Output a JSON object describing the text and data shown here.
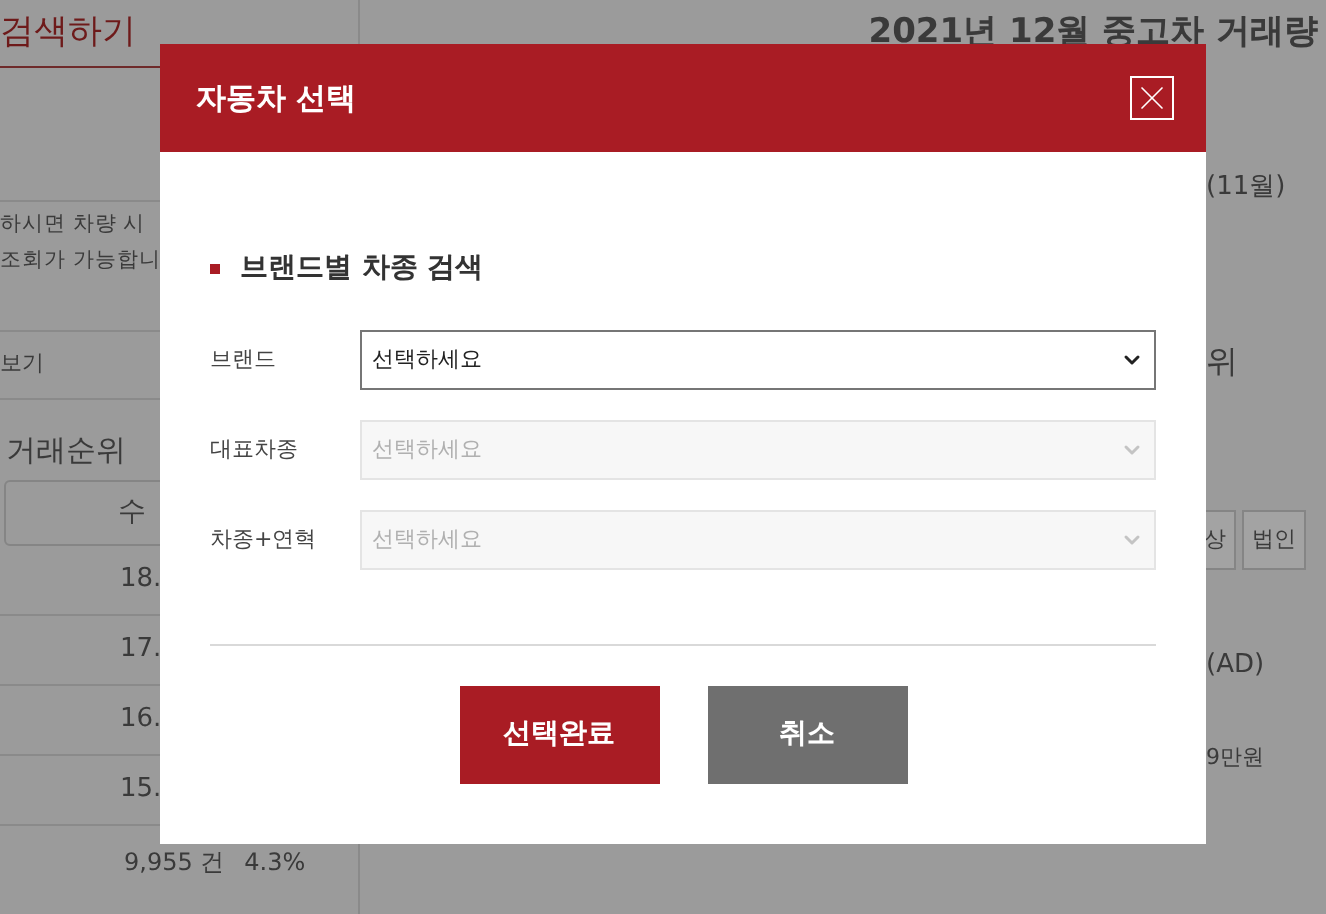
{
  "page": {
    "search_tab": "검색하기",
    "notice_lines": [
      "하시면 차량 시",
      "조회가 가능합니"
    ],
    "view_link": "보기",
    "ranking_title": "거래순위",
    "ranking_tab": "수",
    "ranking_values": [
      "18.",
      "17.",
      "16.",
      "15."
    ],
    "last_row": {
      "count": "9,955 건",
      "share": "4.3%"
    },
    "headline": "2021년 12월 중고차 거래량",
    "period": "(11월)",
    "section_suffix": "위",
    "filters": [
      "상",
      "법인"
    ],
    "ad_label": "(AD)",
    "price": "9만원"
  },
  "dialog": {
    "title": "자동차 선택",
    "section_title": "브랜드별 차종 검색",
    "fields": [
      {
        "label": "브랜드",
        "placeholder": "선택하세요",
        "disabled": false
      },
      {
        "label": "대표차종",
        "placeholder": "선택하세요",
        "disabled": true
      },
      {
        "label": "차종+연혁",
        "placeholder": "선택하세요",
        "disabled": true
      }
    ],
    "buttons": [
      {
        "label": "선택완료",
        "kind": "primary"
      },
      {
        "label": "취소",
        "kind": "secondary"
      }
    ]
  }
}
